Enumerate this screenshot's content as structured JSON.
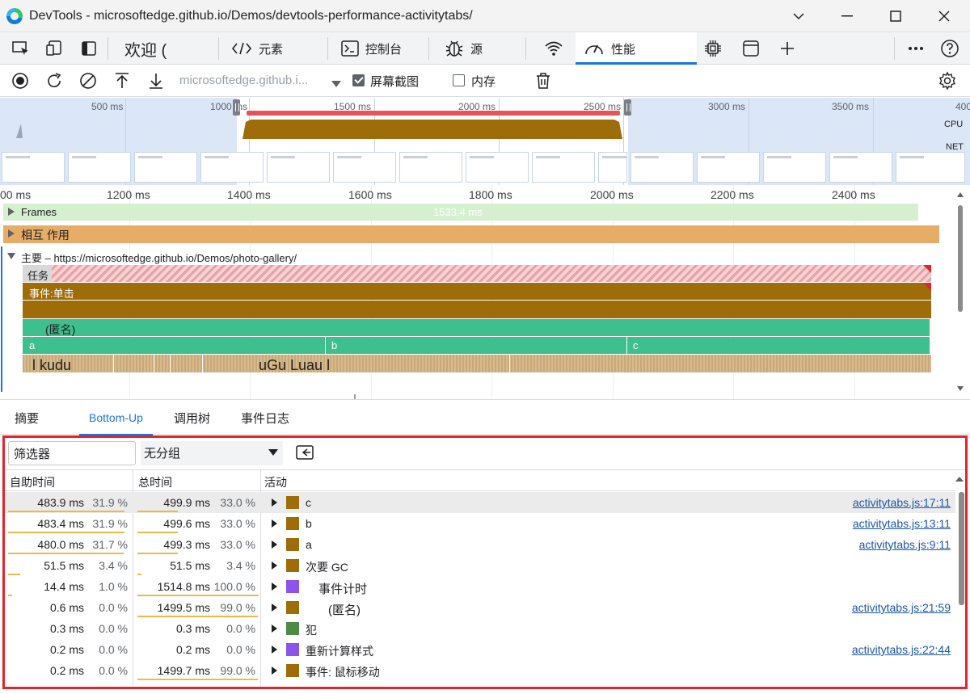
{
  "window": {
    "title": "DevTools - microsoftedge.github.io/Demos/devtools-performance-activitytabs/"
  },
  "tabs": [
    {
      "label": "欢迎 ("
    },
    {
      "label": "元素"
    },
    {
      "label": "控制台"
    },
    {
      "label": "源"
    },
    {
      "label": "性能"
    }
  ],
  "toolbar": {
    "url": "microsoftedge.github.i...",
    "screenshots_label": "屏幕截图",
    "screenshots_checked": true,
    "memory_label": "内存",
    "memory_checked": false
  },
  "overview": {
    "ticks": [
      "500 ms",
      "1000 ms",
      "1500 ms",
      "2000 ms",
      "2500 ms",
      "3000 ms",
      "3500 ms",
      "400"
    ],
    "cpu_label": "CPU",
    "net_label": "NET"
  },
  "timeline": {
    "ticks": [
      "00 ms",
      "1200 ms",
      "1400 ms",
      "1600 ms",
      "1800 ms",
      "2000 ms",
      "2200 ms",
      "2400 ms"
    ],
    "frames_label": "Frames",
    "frames_duration": "1533.4 ms",
    "interactions_label": "相互 作用",
    "main_label": "主要 – https://microsoftedge.github.io/Demos/photo-gallery/",
    "task_label": "任务",
    "event_label": "事件:单击",
    "anon_label": "(匿名)",
    "a_label": "a",
    "b_label": "b",
    "c_label": "c",
    "kudu_label": "l kudu",
    "luau_label": "uGu Luau l"
  },
  "drawer_tabs": [
    {
      "label": "摘要"
    },
    {
      "label": "Bottom-Up"
    },
    {
      "label": "调用树"
    },
    {
      "label": "事件日志"
    }
  ],
  "bottom_up": {
    "filter_placeholder": "筛选器",
    "grouping": "无分组",
    "columns": {
      "self": "自助时间",
      "total": "总时间",
      "activity": "活动"
    },
    "rows": [
      {
        "self_ms": "483.9 ms",
        "self_pct": "31.9 %",
        "self_frac": 0.319,
        "total_ms": "499.9 ms",
        "total_pct": "33.0 %",
        "total_frac": 0.33,
        "name": "c",
        "color": "#9e6c08",
        "link": "activitytabs.js:17:11"
      },
      {
        "self_ms": "483.4 ms",
        "self_pct": "31.9 %",
        "self_frac": 0.319,
        "total_ms": "499.6 ms",
        "total_pct": "33.0 %",
        "total_frac": 0.33,
        "name": "b",
        "color": "#9e6c08",
        "link": "activitytabs.js:13:11"
      },
      {
        "self_ms": "480.0 ms",
        "self_pct": "31.7 %",
        "self_frac": 0.317,
        "total_ms": "499.3 ms",
        "total_pct": "33.0 %",
        "total_frac": 0.33,
        "name": "a",
        "color": "#9e6c08",
        "link": "activitytabs.js:9:11"
      },
      {
        "self_ms": "51.5 ms",
        "self_pct": "3.4 %",
        "self_frac": 0.034,
        "total_ms": "51.5 ms",
        "total_pct": "3.4 %",
        "total_frac": 0.034,
        "name": "次要 GC",
        "color": "#9e6c08",
        "link": ""
      },
      {
        "self_ms": "14.4 ms",
        "self_pct": "1.0 %",
        "self_frac": 0.01,
        "total_ms": "1514.8 ms",
        "total_pct": "100.0 %",
        "total_frac": 1.0,
        "name": "事件计时",
        "color": "#8a55e8",
        "link": ""
      },
      {
        "self_ms": "0.6 ms",
        "self_pct": "0.0 %",
        "self_frac": 0.0,
        "total_ms": "1499.5 ms",
        "total_pct": "99.0 %",
        "total_frac": 0.99,
        "name": "(匿名)",
        "color": "#9e6c08",
        "link": "activitytabs.js:21:59"
      },
      {
        "self_ms": "0.3 ms",
        "self_pct": "0.0 %",
        "self_frac": 0.0,
        "total_ms": "0.3 ms",
        "total_pct": "0.0 %",
        "total_frac": 0.0,
        "name": "犯",
        "color": "#4e8a43",
        "link": ""
      },
      {
        "self_ms": "0.2 ms",
        "self_pct": "0.0 %",
        "self_frac": 0.0,
        "total_ms": "0.2 ms",
        "total_pct": "0.0 %",
        "total_frac": 0.0,
        "name": "重新计算样式",
        "color": "#8a55e8",
        "link": "activitytabs.js:22:44"
      },
      {
        "self_ms": "0.2 ms",
        "self_pct": "0.0 %",
        "self_frac": 0.0,
        "total_ms": "1499.7 ms",
        "total_pct": "99.0 %",
        "total_frac": 0.99,
        "name": "事件: 鼠标移动",
        "color": "#9e6c08",
        "link": ""
      }
    ]
  },
  "colors": {
    "accent": "#1a73e8",
    "highlight_border": "#e3242b",
    "script_brown": "#9e6c08",
    "function_green": "#3dbf8e",
    "frames_green": "#d4f0cf",
    "interactions_orange": "#e7ad66"
  }
}
